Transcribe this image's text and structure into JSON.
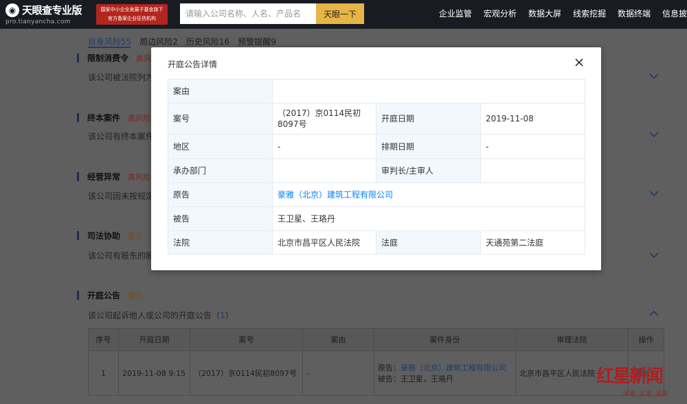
{
  "header": {
    "logo_text": "天眼查专业版",
    "logo_url": "pro.tianyancha.com",
    "badge_line1": "国家中小企业发展子基金旗下",
    "badge_line2": "官方备案企业征信机构",
    "search_placeholder": "请输入公司名称、人名、产品名",
    "search_button": "天眼一下",
    "nav": [
      "企业监管",
      "宏观分析",
      "数据大屏",
      "线索挖掘",
      "数据终端",
      "信息披"
    ]
  },
  "subtabs": [
    "自身风险55",
    "周边风险2",
    "历史风险16",
    "预警提醒9"
  ],
  "sections": [
    {
      "name": "限制消费令",
      "tag": "高风险",
      "desc": "该公司被法院列为"
    },
    {
      "name": "终本案件",
      "tag": "高风险",
      "desc": "该公司有终本案件"
    },
    {
      "name": "经营异常",
      "tag": "高风险",
      "desc": "该公司因未按规定"
    },
    {
      "name": "司法协助",
      "tag": "警示",
      "desc": "该公司有股东的股"
    },
    {
      "name": "开庭公告",
      "tag": "警示",
      "desc_prefix": "该公司起诉他人或公司的开庭公告（",
      "desc_count": "1",
      "desc_suffix": "）"
    }
  ],
  "bottom_table": {
    "headers": [
      "序号",
      "开庭日期",
      "案号",
      "案由",
      "案件身份",
      "审理法院",
      "操作"
    ],
    "row": {
      "index": "1",
      "date": "2019-11-08 9:15",
      "case_no": "（2017）京0114民初8097号",
      "cause": "-",
      "plaintiff_label": "原告：",
      "plaintiff": "豪雅（北京）建筑工程有限公司",
      "defendant_label": "被告：",
      "defendant": "王卫星，王珞丹",
      "court": "北京市昌平区人民法院",
      "action": "详情"
    }
  },
  "watermark": {
    "main": "红星新闻",
    "sub": "深度 态度 温度"
  },
  "modal": {
    "title": "开庭公告详情",
    "fields": {
      "cause_label": "案由",
      "cause_value": "",
      "case_no_label": "案号",
      "case_no_value": "（2017）京0114民初8097号",
      "open_date_label": "开庭日期",
      "open_date_value": "2019-11-08",
      "region_label": "地区",
      "region_value": "-",
      "schedule_label": "排期日期",
      "schedule_value": "-",
      "dept_label": "承办部门",
      "dept_value": "",
      "judge_label": "审判长/主审人",
      "judge_value": "",
      "plaintiff_label": "原告",
      "plaintiff_value": "豪雅（北京）建筑工程有限公司",
      "defendant_label": "被告",
      "defendant_value": "王卫星、王珞丹",
      "court_label": "法院",
      "court_value": "北京市昌平区人民法院",
      "courtroom_label": "法庭",
      "courtroom_value": "天通苑第二法庭"
    }
  },
  "colors": {
    "accent": "#0084ff",
    "label_bg": "#f2f8fc",
    "overlay": "#5f5f5f",
    "topbar": "#181c22",
    "search_btn": "#e7b545"
  }
}
